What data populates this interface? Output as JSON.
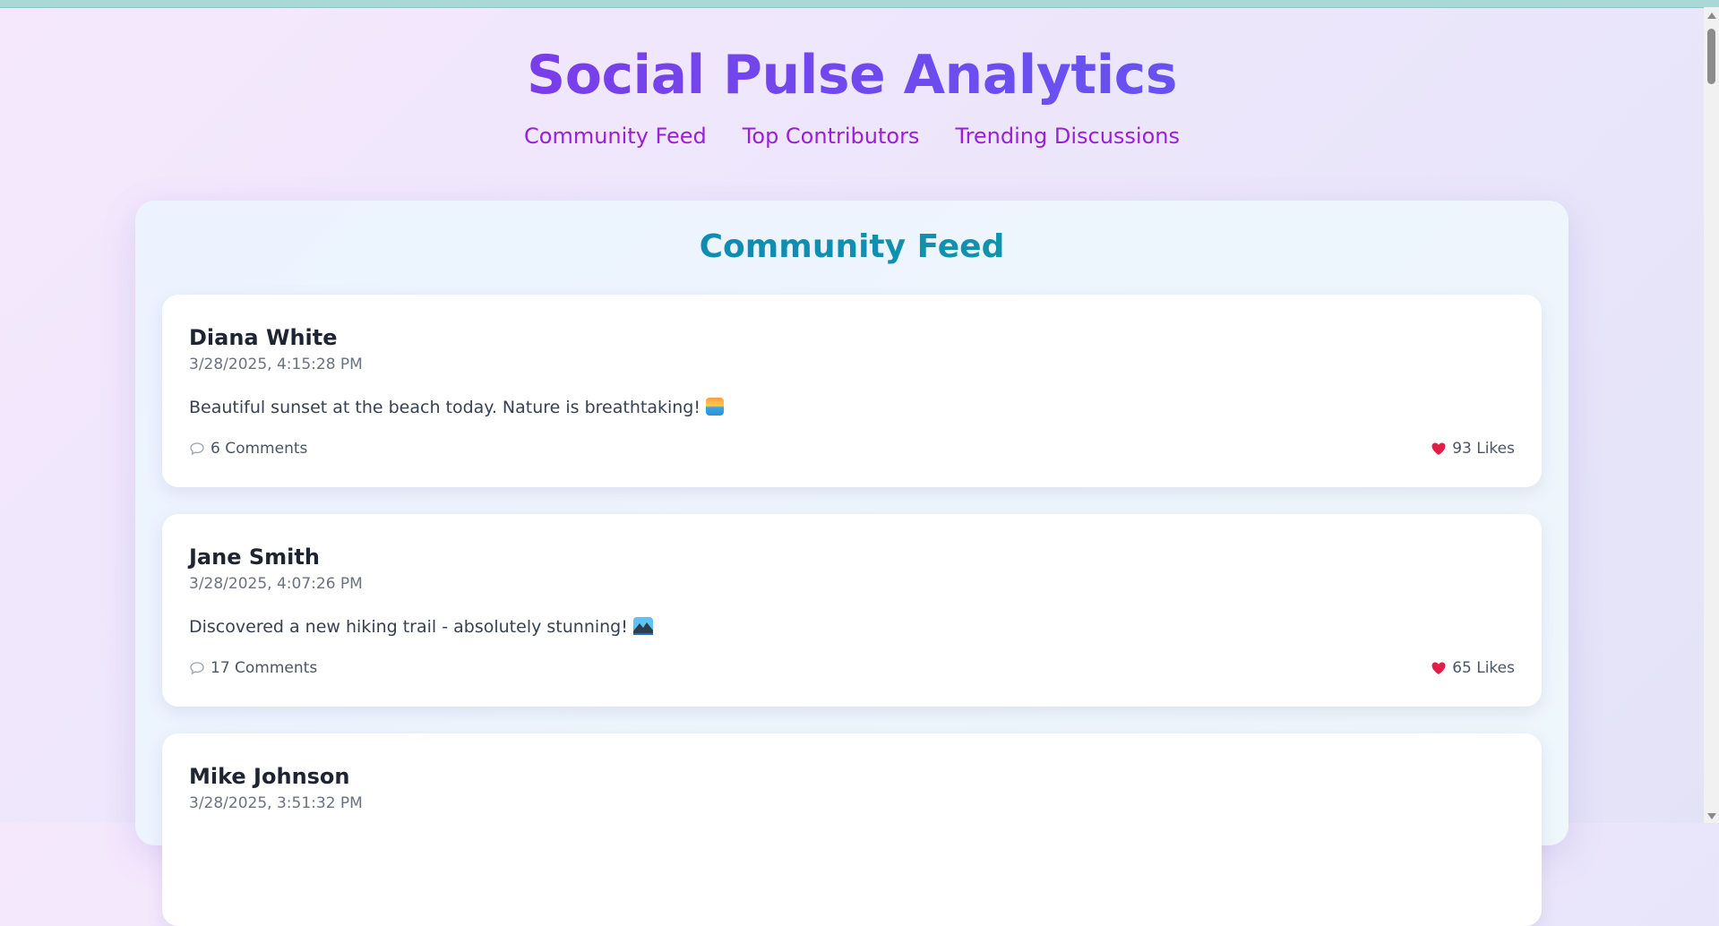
{
  "app": {
    "title": "Social Pulse Analytics"
  },
  "nav": {
    "items": [
      {
        "label": "Community Feed"
      },
      {
        "label": "Top Contributors"
      },
      {
        "label": "Trending Discussions"
      }
    ]
  },
  "feed": {
    "title": "Community Feed",
    "posts": [
      {
        "author": "Diana White",
        "timestamp": "3/28/2025, 4:15:28 PM",
        "content": "Beautiful sunset at the beach today. Nature is breathtaking!",
        "emoji_icon": "sunset-emoji-icon",
        "comments": "6 Comments",
        "likes": "93 Likes"
      },
      {
        "author": "Jane Smith",
        "timestamp": "3/28/2025, 4:07:26 PM",
        "content": "Discovered a new hiking trail - absolutely stunning!",
        "emoji_icon": "mountain-emoji-icon",
        "comments": "17 Comments",
        "likes": "65 Likes"
      },
      {
        "author": "Mike Johnson",
        "timestamp": "3/28/2025, 3:51:32 PM"
      }
    ]
  },
  "colors": {
    "title_gradient_start": "#8a2be2",
    "title_gradient_end": "#5e5af2",
    "nav_link": "#9b1fd8",
    "panel_title_start": "#0b7fc0",
    "panel_title_end": "#13a0a0",
    "heart": "#e11d48"
  }
}
